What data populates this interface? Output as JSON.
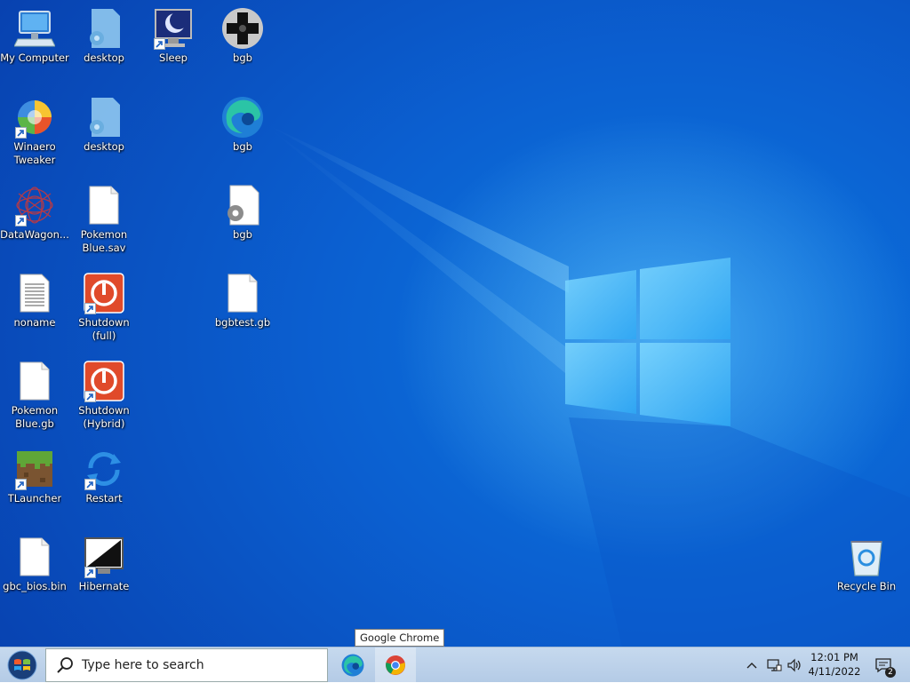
{
  "desktop": {
    "icons": [
      {
        "label": "My Computer",
        "icon": "computer-icon"
      },
      {
        "label": "desktop",
        "icon": "settings-file-icon"
      },
      {
        "label": "Sleep",
        "icon": "sleep-monitor-icon"
      },
      {
        "label": "bgb",
        "icon": "gamepad-icon"
      },
      {
        "label": "Winaero\nTweaker",
        "icon": "winaero-tweaker-icon"
      },
      {
        "label": "desktop",
        "icon": "settings-file-icon"
      },
      {
        "label": "bgb",
        "icon": "edge-icon"
      },
      {
        "label": "DataWagon...",
        "icon": "datawagon-icon"
      },
      {
        "label": "Pokemon\nBlue.sav",
        "icon": "blank-file-icon"
      },
      {
        "label": "bgb",
        "icon": "settings-file-icon"
      },
      {
        "label": "noname",
        "icon": "text-file-icon"
      },
      {
        "label": "Shutdown\n(full)",
        "icon": "power-icon"
      },
      {
        "label": "bgbtest.gb",
        "icon": "blank-file-icon"
      },
      {
        "label": "Pokemon\nBlue.gb",
        "icon": "blank-file-icon"
      },
      {
        "label": "Shutdown\n(Hybrid)",
        "icon": "power-icon"
      },
      {
        "label": "TLauncher",
        "icon": "minecraft-block-icon"
      },
      {
        "label": "Restart",
        "icon": "restart-icon"
      },
      {
        "label": "gbc_bios.bin",
        "icon": "blank-file-icon"
      },
      {
        "label": "Hibernate",
        "icon": "hibernate-monitor-icon"
      },
      {
        "label": "Recycle Bin",
        "icon": "recycle-bin-icon"
      }
    ]
  },
  "taskbar": {
    "search_placeholder": "Type here to search",
    "pinned": [
      {
        "name": "Microsoft Edge",
        "icon": "edge-icon"
      },
      {
        "name": "Google Chrome",
        "icon": "chrome-icon"
      }
    ],
    "tooltip": "Google Chrome",
    "clock": {
      "time": "12:01 PM",
      "date": "4/11/2022"
    },
    "notifications_count": "2"
  },
  "colors": {
    "desktop_blue": "#0b5fd0",
    "taskbar": "#c6d9ee",
    "power_red": "#e04a2a"
  }
}
